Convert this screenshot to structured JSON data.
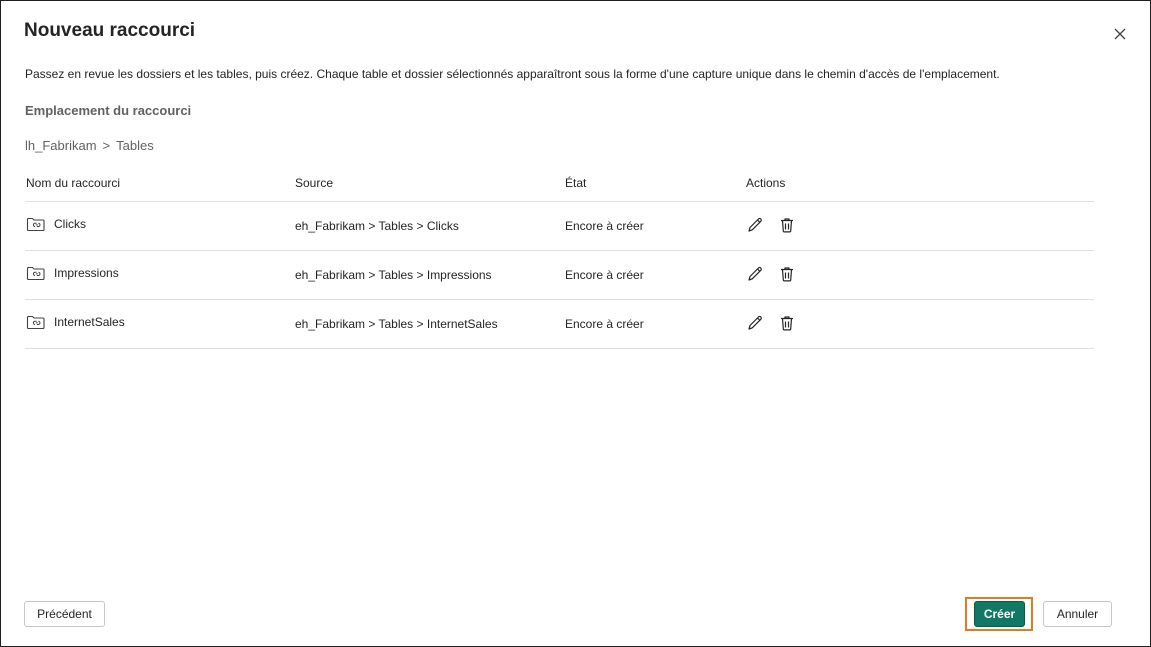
{
  "dialog": {
    "title": "Nouveau raccourci",
    "description": "Passez en revue les dossiers et les tables, puis créez. Chaque table et dossier sélectionnés apparaîtront sous la forme d'une capture unique dans le chemin d'accès de l'emplacement.",
    "location_label": "Emplacement du raccourci",
    "breadcrumb": [
      "lh_Fabrikam",
      ">",
      "Tables"
    ],
    "close_icon": "close-icon"
  },
  "table": {
    "headers": {
      "name": "Nom du raccourci",
      "source": "Source",
      "state": "État",
      "actions": "Actions"
    },
    "rows": [
      {
        "name": "Clicks",
        "source": "eh_Fabrikam > Tables > Clicks",
        "state": "Encore à créer"
      },
      {
        "name": "Impressions",
        "source": "eh_Fabrikam > Tables > Impressions",
        "state": "Encore à créer"
      },
      {
        "name": "InternetSales",
        "source": "eh_Fabrikam > Tables > InternetSales",
        "state": "Encore à créer"
      }
    ],
    "row_icon": "folder-shortcut-icon",
    "action_icons": [
      "edit-icon",
      "delete-icon"
    ]
  },
  "footer": {
    "previous_label": "Précédent",
    "create_label": "Créer",
    "cancel_label": "Annuler"
  },
  "colors": {
    "primary": "#117865",
    "highlight": "#e07a24"
  }
}
